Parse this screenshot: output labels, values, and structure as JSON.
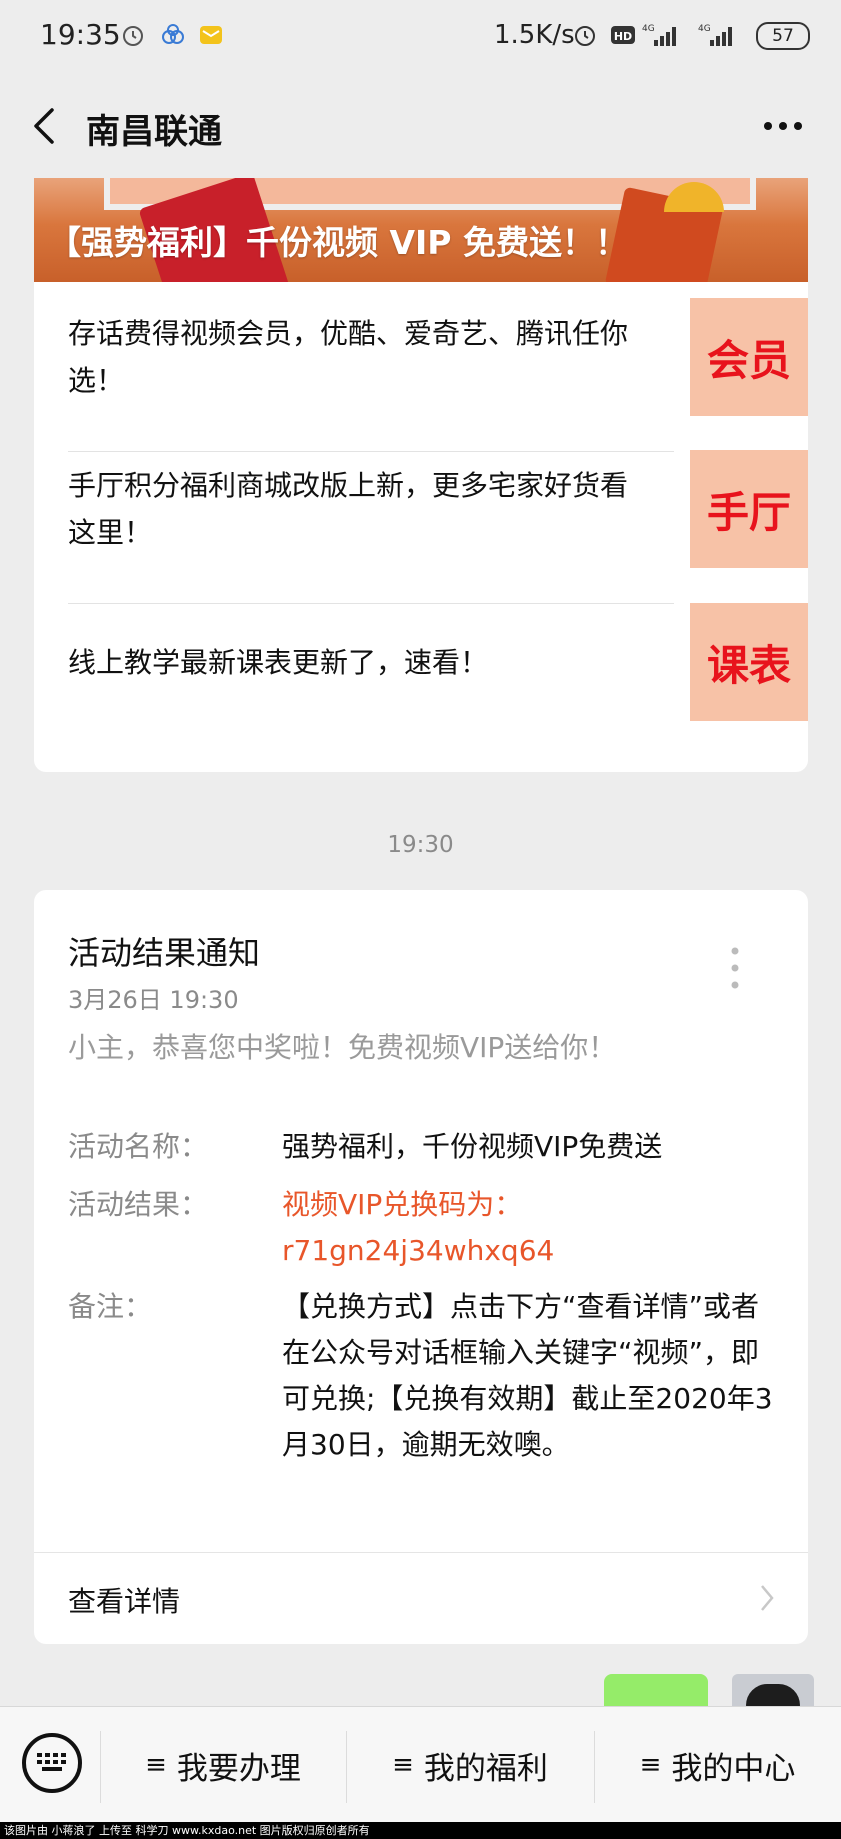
{
  "status_bar": {
    "time": "19:35",
    "net_speed": "1.5K/s",
    "battery": "57",
    "icons": [
      "alarm-icon",
      "app-icon",
      "message-icon",
      "alarm-icon",
      "hd-icon",
      "signal-4g-icon",
      "signal-4g-icon"
    ]
  },
  "nav": {
    "title": "南昌联通"
  },
  "article": {
    "banner_title": "【强势福利】千份视频 VIP 免费送！！",
    "items": [
      {
        "text": "存话费得视频会员，优酷、爱奇艺、腾讯任你选！",
        "thumb": "会员"
      },
      {
        "text": "手厅积分福利商城改版上新，更多宅家好货看这里！",
        "thumb": "手厅"
      },
      {
        "text": "线上教学最新课表更新了，速看！",
        "thumb": "课表"
      }
    ]
  },
  "timestamp": "19:30",
  "notification": {
    "title": "活动结果通知",
    "date": "3月26日  19:30",
    "intro": "小主，恭喜您中奖啦！免费视频VIP送给你！",
    "fields": [
      {
        "label": "活动名称：",
        "value": "强势福利，千份视频VIP免费送"
      },
      {
        "label": "活动结果：",
        "value": "视频VIP兑换码为：r71gn24j34whxq64"
      },
      {
        "label": "备注：",
        "value": "【兑换方式】点击下方“查看详情”或者在公众号对话框输入关键字“视频”，即可兑换;【兑换有效期】截止至2020年3月30日，逾期无效噢。"
      }
    ],
    "detail_label": "查看详情"
  },
  "bottom_menu": {
    "hamburger": "≡",
    "items": [
      "我要办理",
      "我的福利",
      "我的中心"
    ]
  },
  "footer": "该图片由 小蒋浪了 上传至 科学刀 www.kxdao.net 图片版权归原创者所有",
  "colors": {
    "accent_red": "#e8131c",
    "code_orange": "#e8562a",
    "bubble_green": "#95ec69",
    "background": "#ededed"
  }
}
